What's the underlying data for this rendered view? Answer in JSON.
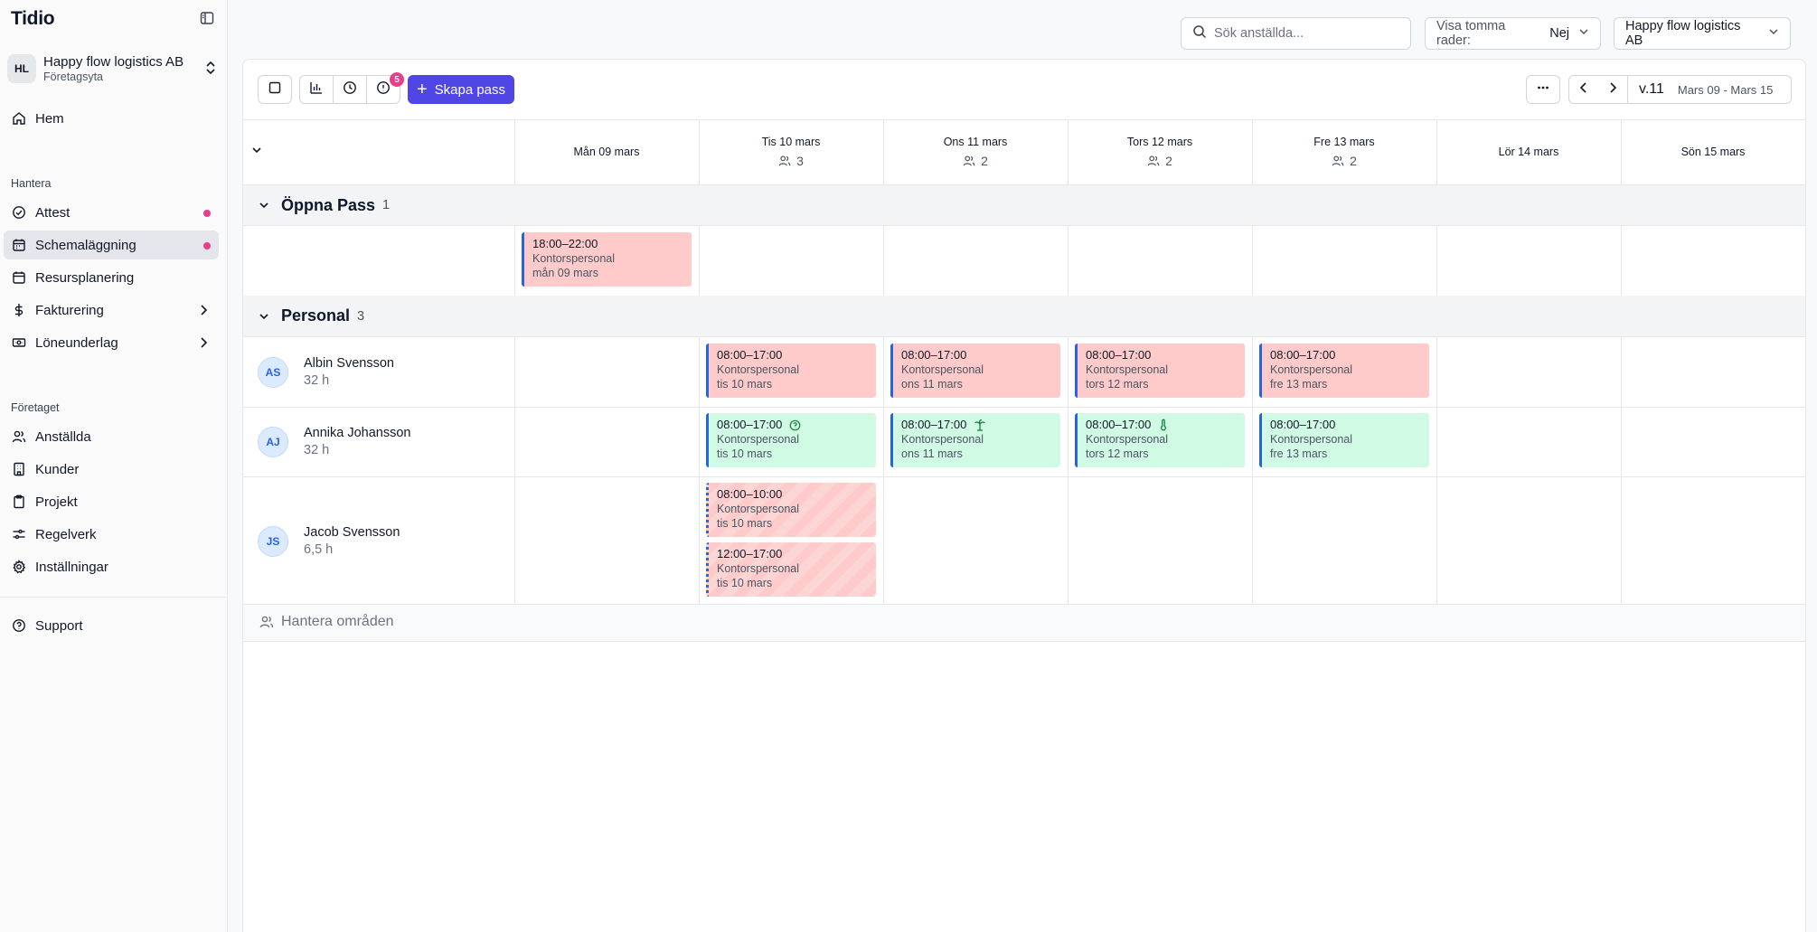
{
  "sidebar": {
    "logo": "Tidio",
    "workspace": {
      "initials": "HL",
      "name": "Happy flow logistics AB",
      "subtitle": "Företagsyta"
    },
    "home": "Hem",
    "section_manage": "Hantera",
    "manage_items": [
      {
        "label": "Attest",
        "icon": "check-circle-icon",
        "dot": true
      },
      {
        "label": "Schemaläggning",
        "icon": "calendar-icon",
        "dot": true,
        "active": true
      },
      {
        "label": "Resursplanering",
        "icon": "calendar-icon"
      },
      {
        "label": "Fakturering",
        "icon": "dollar-icon",
        "chevron": true
      },
      {
        "label": "Löneunderlag",
        "icon": "banknote-icon",
        "chevron": true
      }
    ],
    "section_company": "Företaget",
    "company_items": [
      {
        "label": "Anställda",
        "icon": "users-icon"
      },
      {
        "label": "Kunder",
        "icon": "building-icon"
      },
      {
        "label": "Projekt",
        "icon": "clipboard-icon"
      },
      {
        "label": "Regelverk",
        "icon": "sliders-icon"
      },
      {
        "label": "Inställningar",
        "icon": "gear-icon"
      }
    ],
    "support": "Support"
  },
  "topbar": {
    "search_placeholder": "Sök anställda...",
    "empty_rows_label": "Visa tomma rader:",
    "empty_rows_value": "Nej",
    "company_select": "Happy flow logistics AB"
  },
  "toolbar": {
    "badge_count": "5",
    "create_label": "Skapa pass",
    "week_label": "v.11",
    "week_range": "Mars 09 - Mars 15"
  },
  "days": [
    {
      "label": "Mån 09 mars",
      "count": ""
    },
    {
      "label": "Tis 10 mars",
      "count": "3"
    },
    {
      "label": "Ons 11 mars",
      "count": "2"
    },
    {
      "label": "Tors 12 mars",
      "count": "2"
    },
    {
      "label": "Fre 13 mars",
      "count": "2"
    },
    {
      "label": "Lör 14 mars",
      "count": ""
    },
    {
      "label": "Sön 15 mars",
      "count": ""
    }
  ],
  "groups": {
    "open": {
      "title": "Öppna Pass",
      "count": "1"
    },
    "staff": {
      "title": "Personal",
      "count": "3"
    }
  },
  "open_shifts": [
    {
      "day": 0,
      "time": "18:00–22:00",
      "role": "Kontorspersonal",
      "date": "mån 09 mars",
      "style": "red"
    }
  ],
  "employees": [
    {
      "initials": "AS",
      "name": "Albin Svensson",
      "hours": "32 h",
      "shifts": [
        {
          "day": 1,
          "time": "08:00–17:00",
          "role": "Kontorspersonal",
          "date": "tis 10 mars",
          "style": "red"
        },
        {
          "day": 2,
          "time": "08:00–17:00",
          "role": "Kontorspersonal",
          "date": "ons 11 mars",
          "style": "red"
        },
        {
          "day": 3,
          "time": "08:00–17:00",
          "role": "Kontorspersonal",
          "date": "tors 12 mars",
          "style": "red"
        },
        {
          "day": 4,
          "time": "08:00–17:00",
          "role": "Kontorspersonal",
          "date": "fre 13 mars",
          "style": "red"
        }
      ]
    },
    {
      "initials": "AJ",
      "name": "Annika Johansson",
      "hours": "32 h",
      "shifts": [
        {
          "day": 1,
          "time": "08:00–17:00",
          "role": "Kontorspersonal",
          "date": "tis 10 mars",
          "style": "green",
          "icon": "question-circle-icon"
        },
        {
          "day": 2,
          "time": "08:00–17:00",
          "role": "Kontorspersonal",
          "date": "ons 11 mars",
          "style": "green",
          "icon": "palm-tree-icon"
        },
        {
          "day": 3,
          "time": "08:00–17:00",
          "role": "Kontorspersonal",
          "date": "tors 12 mars",
          "style": "green",
          "icon": "thermometer-icon"
        },
        {
          "day": 4,
          "time": "08:00–17:00",
          "role": "Kontorspersonal",
          "date": "fre 13 mars",
          "style": "green"
        }
      ]
    },
    {
      "initials": "JS",
      "name": "Jacob Svensson",
      "hours": "6,5 h",
      "shifts": [
        {
          "day": 1,
          "time": "08:00–10:00",
          "role": "Kontorspersonal",
          "date": "tis 10 mars",
          "style": "hatched"
        },
        {
          "day": 1,
          "time": "12:00–17:00",
          "role": "Kontorspersonal",
          "date": "tis 10 mars",
          "style": "hatched"
        }
      ]
    }
  ],
  "manage_areas": "Hantera områden"
}
